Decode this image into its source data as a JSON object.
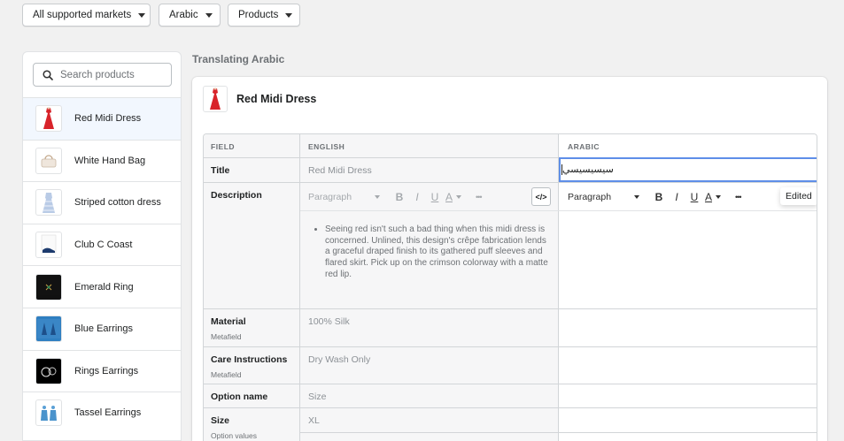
{
  "filters": {
    "markets": "All supported markets",
    "language": "Arabic",
    "resource": "Products"
  },
  "search": {
    "placeholder": "Search products"
  },
  "products": [
    {
      "name": "Red Midi Dress",
      "active": true
    },
    {
      "name": "White Hand Bag"
    },
    {
      "name": "Striped cotton dress"
    },
    {
      "name": "Club C Coast"
    },
    {
      "name": "Emerald Ring"
    },
    {
      "name": "Blue Earrings"
    },
    {
      "name": "Rings Earrings"
    },
    {
      "name": "Tassel Earrings"
    }
  ],
  "heading": "Translating Arabic",
  "product": {
    "title": "Red Midi Dress"
  },
  "table": {
    "headers": {
      "field": "FIELD",
      "english": "ENGLISH",
      "arabic": "ARABIC"
    },
    "title": {
      "label": "Title",
      "english": "Red Midi Dress",
      "arabic": "سيسيسيسي"
    },
    "description": {
      "label": "Description",
      "english": "Seeing red isn't such a bad thing when this midi dress is concerned. Unlined, this design's crêpe fabrication lends a graceful draped finish to its gathered puff sleeves and flared skirt. Pick up on the crimson colorway with a matte red lip.",
      "arabic": ""
    },
    "material": {
      "label": "Material",
      "sub": "Metafield",
      "english": "100% Silk"
    },
    "care": {
      "label": "Care Instructions",
      "sub": "Metafield",
      "english": "Dry Wash Only"
    },
    "option_name": {
      "label": "Option name",
      "english": "Size"
    },
    "size": {
      "label": "Size",
      "sub": "Option values",
      "english": "XL"
    }
  },
  "editor": {
    "paragraph": "Paragraph",
    "bold": "B",
    "italic": "I",
    "underline": "U",
    "color": "A",
    "more": "•••",
    "code": "</>",
    "edited": "Edited"
  }
}
